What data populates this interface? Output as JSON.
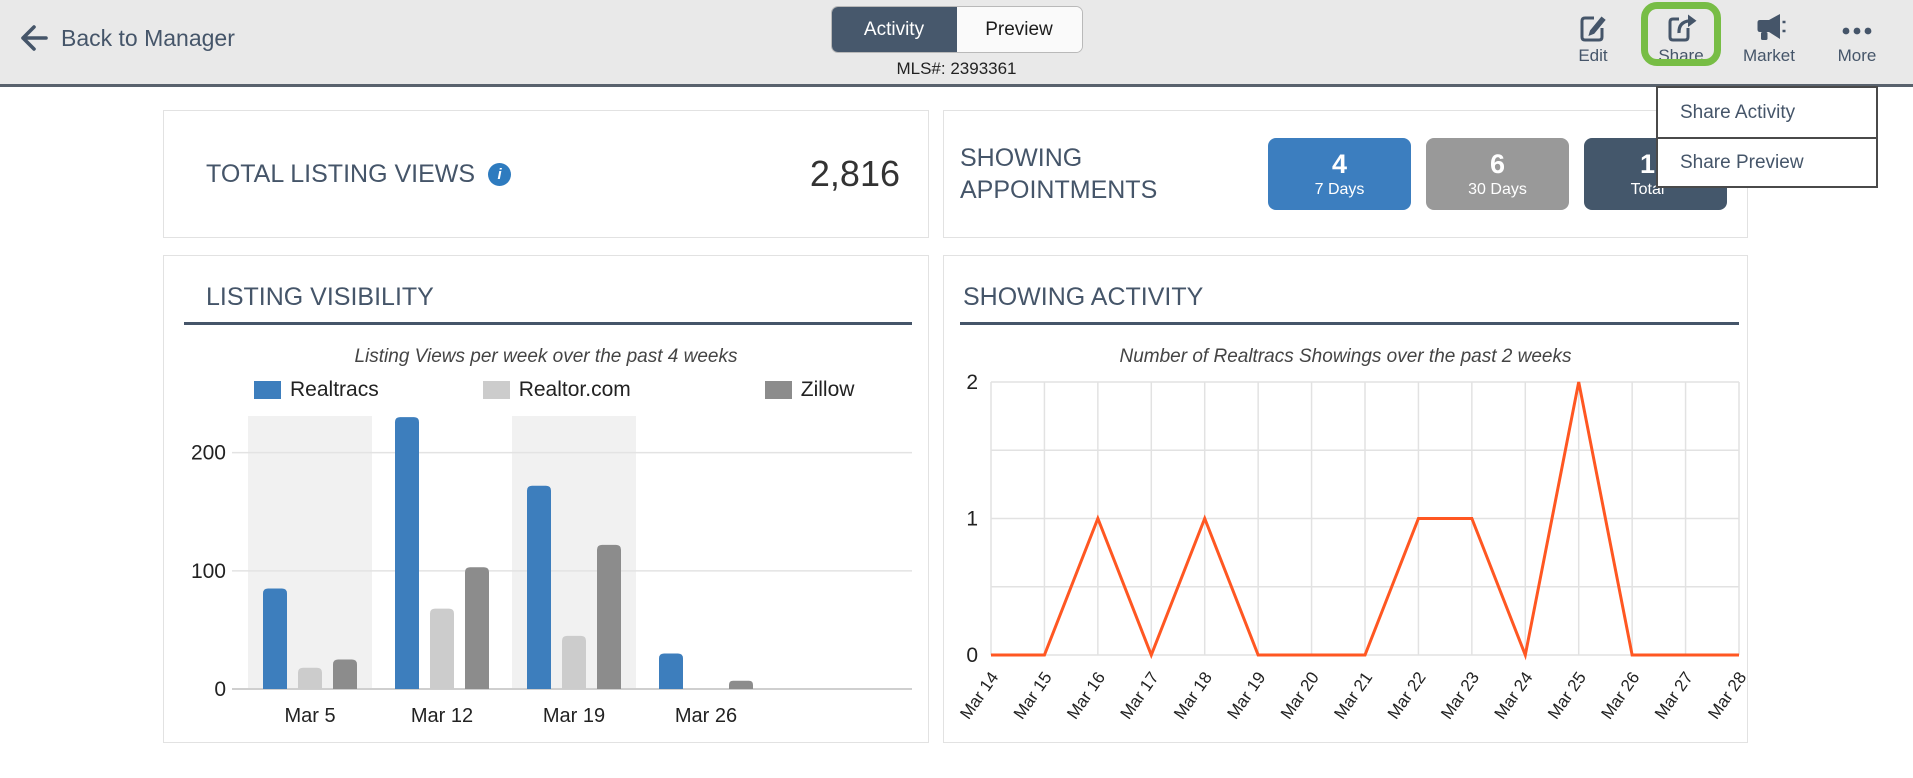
{
  "topbar": {
    "back_label": "Back to Manager",
    "tabs": [
      {
        "label": "Activity",
        "active": true
      },
      {
        "label": "Preview",
        "active": false
      }
    ],
    "mls_label": "MLS#: 2393361",
    "actions": [
      {
        "label": "Edit"
      },
      {
        "label": "Share",
        "highlighted": true
      },
      {
        "label": "Market"
      },
      {
        "label": "More"
      }
    ]
  },
  "colors": {
    "share_highlight": "#77bd45",
    "slate": "#455569"
  },
  "share_menu": {
    "items": [
      {
        "label": "Share Activity"
      },
      {
        "label": "Share Preview"
      }
    ]
  },
  "cards": {
    "total_listing_views": {
      "title": "TOTAL LISTING VIEWS",
      "value": "2,816"
    },
    "showing_appointments": {
      "title_line1": "SHOWING",
      "title_line2": "APPOINTMENTS",
      "badges": [
        {
          "value": "4",
          "label": "7 Days",
          "color": "#3c7ebf"
        },
        {
          "value": "6",
          "label": "30 Days",
          "color": "#999999"
        },
        {
          "value": "1",
          "label": "Total",
          "color": "#44576b"
        }
      ]
    },
    "listing_visibility": {
      "title": "LISTING VISIBILITY"
    },
    "showing_activity": {
      "title": "SHOWING ACTIVITY"
    }
  },
  "chart_data": [
    {
      "type": "bar",
      "title": "Listing Views per week over the past 4 weeks",
      "categories": [
        "Mar 5",
        "Mar 12",
        "Mar 19",
        "Mar 26"
      ],
      "series": [
        {
          "name": "Realtracs",
          "color": "#3d7ebd",
          "values": [
            85,
            230,
            172,
            30
          ]
        },
        {
          "name": "Realtor.com",
          "color": "#cccccc",
          "values": [
            18,
            68,
            45,
            0
          ]
        },
        {
          "name": "Zillow",
          "color": "#8c8c8c",
          "values": [
            25,
            103,
            122,
            7
          ]
        }
      ],
      "ylim": [
        0,
        231
      ],
      "yticks": [
        0,
        100,
        200
      ],
      "band_color": "#f1f1f1",
      "banded_categories": [
        0,
        2
      ],
      "legend_position": "top",
      "grid": true
    },
    {
      "type": "line",
      "title": "Number of Realtracs Showings over the past 2 weeks",
      "x": [
        "Mar 14",
        "Mar 15",
        "Mar 16",
        "Mar 17",
        "Mar 18",
        "Mar 19",
        "Mar 20",
        "Mar 21",
        "Mar 22",
        "Mar 23",
        "Mar 24",
        "Mar 25",
        "Mar 26",
        "Mar 27",
        "Mar 28"
      ],
      "values": [
        0,
        0,
        1,
        0,
        1,
        0,
        0,
        0,
        1,
        1,
        0,
        2,
        0,
        0,
        0
      ],
      "color": "#ff5722",
      "ylim": [
        0,
        2
      ],
      "yticks": [
        0,
        1,
        2
      ],
      "grid": true
    }
  ]
}
